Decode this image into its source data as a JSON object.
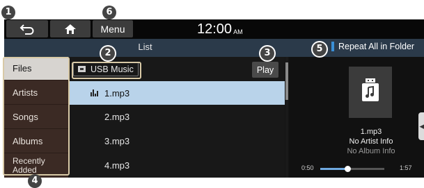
{
  "callouts": [
    "1",
    "6",
    "2",
    "3",
    "5",
    "4"
  ],
  "topbar": {
    "menu_label": "Menu",
    "time": "12:00",
    "ampm": "AM"
  },
  "title": "List",
  "repeat_label": "Repeat All in Folder",
  "categories": [
    "Files",
    "Artists",
    "Songs",
    "Albums",
    "Recently Added"
  ],
  "path_label": "USB Music",
  "play_label": "Play",
  "files": [
    "1.mp3",
    "2.mp3",
    "3.mp3",
    "4.mp3"
  ],
  "now_playing": {
    "title": "1.mp3",
    "artist": "No Artist Info",
    "album": "No Album Info",
    "elapsed": "0:50",
    "duration": "1:57",
    "progress": 0.43
  },
  "colors": {
    "accent": "#3a8fd6",
    "selected_row": "#b9d3ea",
    "titlebar": "#2b3a4a"
  }
}
